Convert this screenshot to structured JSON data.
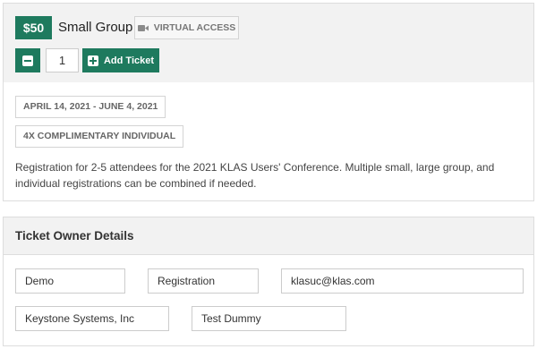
{
  "ticket": {
    "price": "$50",
    "name": "Small Group",
    "virtual_label": "VIRTUAL ACCESS",
    "virtual_icon": "video-camera-icon",
    "quantity": "1",
    "add_label": "Add Ticket",
    "date_range": "APRIL 14, 2021 - JUNE 4, 2021",
    "complimentary": "4X COMPLIMENTARY INDIVIDUAL",
    "description": "Registration for 2-5 attendees for the 2021 KLAS Users' Conference. Multiple small, large group, and individual registrations can be combined if needed."
  },
  "owner": {
    "title": "Ticket Owner Details",
    "first_name": "Demo",
    "last_name": "Registration",
    "email": "klasuc@klas.com",
    "company": "Keystone Systems, Inc",
    "full_name": "Test Dummy"
  },
  "colors": {
    "accent": "#1e7a5e",
    "header_bg": "#f2f2f2",
    "border": "#dddddd"
  }
}
